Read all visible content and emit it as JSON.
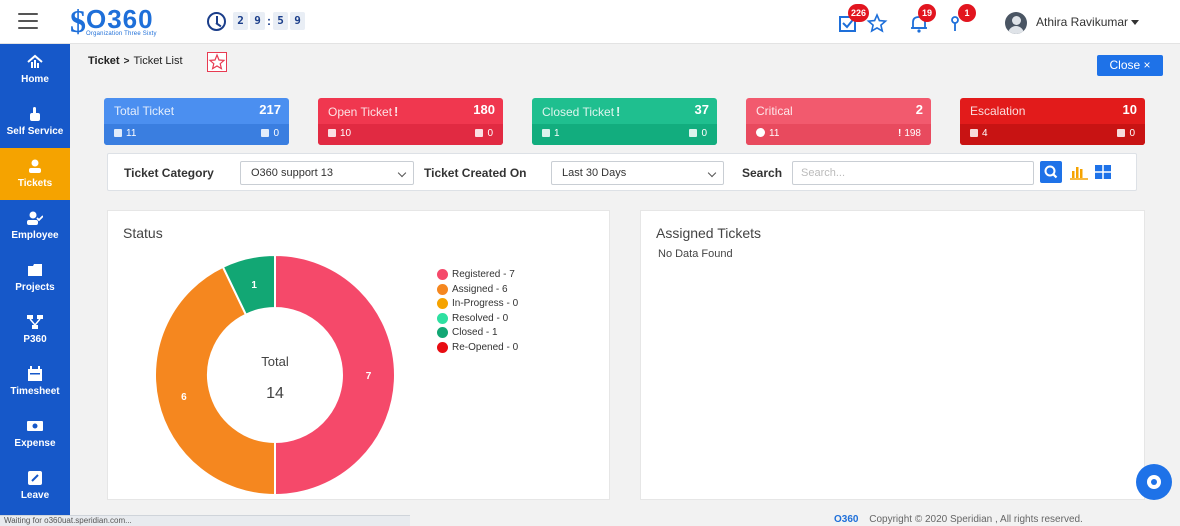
{
  "header": {
    "logo_text": "O360",
    "logo_sub": "Organization Three Sixty",
    "timer_digits": [
      "2",
      "9",
      "5",
      "9"
    ],
    "timer_sep": ":",
    "badges": {
      "tasks": "226",
      "notifications": "19",
      "alerts": "1"
    },
    "user_name": "Athira Ravikumar"
  },
  "sidebar": {
    "items": [
      {
        "label": "Home",
        "icon": "home-icon"
      },
      {
        "label": "Self Service",
        "icon": "hand-pointer-icon"
      },
      {
        "label": "Tickets",
        "icon": "ticket-icon",
        "active": true
      },
      {
        "label": "Employee",
        "icon": "user-check-icon"
      },
      {
        "label": "Projects",
        "icon": "folder-icon"
      },
      {
        "label": "P360",
        "icon": "sitemap-icon"
      },
      {
        "label": "Timesheet",
        "icon": "calendar-icon"
      },
      {
        "label": "Expense",
        "icon": "money-icon"
      },
      {
        "label": "Leave",
        "icon": "edit-icon"
      }
    ],
    "active_color": "#f5a300",
    "bg_color": "#1658c9"
  },
  "breadcrumb": {
    "root": "Ticket",
    "sep": ">",
    "current": "Ticket List"
  },
  "close_button": "Close ×",
  "cards": [
    {
      "title": "Total Ticket",
      "value": "217",
      "left": "11",
      "right": "0",
      "color": "#4b8ff0",
      "foot": "#3a7ee0"
    },
    {
      "title": "Open Ticket",
      "value": "180",
      "left": "10",
      "right": "0",
      "color": "#f0374f",
      "foot": "#e12a42",
      "alert": true
    },
    {
      "title": "Closed Ticket",
      "value": "37",
      "left": "1",
      "right": "0",
      "color": "#1fbf8f",
      "foot": "#12ad7e",
      "alert": true
    },
    {
      "title": "Critical",
      "value": "2",
      "left": "11",
      "right": "198",
      "color": "#f25a6e",
      "foot": "#e84a5e"
    },
    {
      "title": "Escalation",
      "value": "10",
      "left": "4",
      "right": "0",
      "color": "#e21b1b",
      "foot": "#c81313"
    }
  ],
  "filters": {
    "category_label": "Ticket Category",
    "category_value": "O360 support 13",
    "created_label": "Ticket Created On",
    "created_value": "Last 30 Days",
    "search_label": "Search",
    "search_placeholder": "Search..."
  },
  "status_panel": {
    "title": "Status",
    "total_label": "Total",
    "total_value": "14"
  },
  "assigned_panel": {
    "title": "Assigned Tickets",
    "empty_text": "No Data Found"
  },
  "chart_data": {
    "type": "pie",
    "variant": "donut",
    "title": "Status",
    "categories": [
      "Registered",
      "Assigned",
      "In-Progress",
      "Resolved",
      "Closed",
      "Re-Opened"
    ],
    "values": [
      7,
      6,
      0,
      0,
      1,
      0
    ],
    "legend_labels": [
      "Registered - 7",
      "Assigned - 6",
      "In-Progress - 0",
      "Resolved - 0",
      "Closed - 1",
      "Re-Opened - 0"
    ],
    "colors": [
      "#f5496a",
      "#f5871f",
      "#f5a300",
      "#2ee0a1",
      "#12a774",
      "#e80c12"
    ],
    "center_label": "Total",
    "center_value": 14,
    "legend_position": "right"
  },
  "status_bar": "Waiting for o360uat.speridian.com...",
  "footer": {
    "logo": "O360",
    "copyright": "Copyright © 2020 Speridian , All rights reserved."
  }
}
